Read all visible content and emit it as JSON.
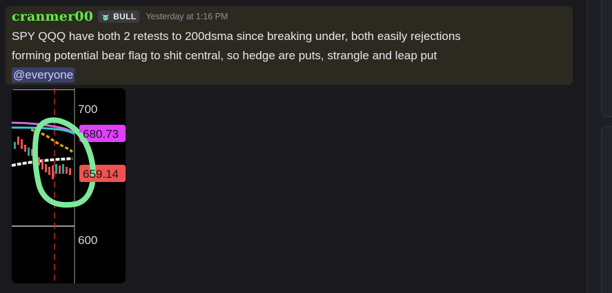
{
  "message": {
    "username": "cranmer00",
    "role_badge": {
      "icon": "bull-icon",
      "label": "BULL"
    },
    "timestamp": "Yesterday at 1:16 PM",
    "text_line1": "SPY QQQ have both 2 retests to 200dsma since breaking under, both easily rejections",
    "text_line2": "forming potential bear flag to shit central, so hedge are puts, strangle and leap put",
    "mention": "@everyone"
  },
  "attachment": {
    "type": "chart-screenshot",
    "axis_labels": {
      "upper": "700",
      "lower": "600"
    },
    "price_tags": [
      {
        "label": "680.73",
        "color": "#e040fb"
      },
      {
        "label": "659.14",
        "color": "#ef5350"
      }
    ],
    "annotation_color": "#7ee89a"
  },
  "colors": {
    "username": "#64e84a",
    "highlight_bg": "#2c2a20",
    "mention_bg": "#3b3f6b"
  }
}
